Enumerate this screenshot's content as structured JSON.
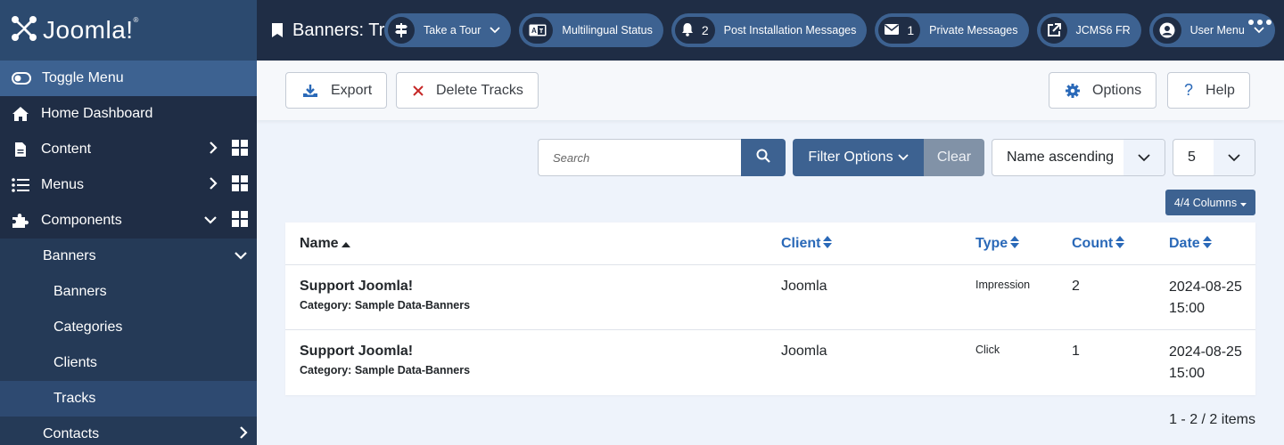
{
  "brand": {
    "logo_text": "Joomla!",
    "registered": "®"
  },
  "header": {
    "page_title": "Banners: Tracks",
    "pills": [
      {
        "label": "Take a Tour",
        "icon": "signpost-icon",
        "has_chevron": true
      },
      {
        "label": "Multilingual Status",
        "icon": "language-icon"
      },
      {
        "label": "Post Installation Messages",
        "icon": "bell-icon",
        "count": "2"
      },
      {
        "label": "Private Messages",
        "icon": "envelope-icon",
        "count": "1"
      },
      {
        "label": "JCMS6 FR",
        "icon": "external-link-icon"
      },
      {
        "label": "User Menu",
        "icon": "user-circle-icon",
        "has_chevron": true
      }
    ],
    "more_label": "More"
  },
  "sidebar": {
    "toggle_label": "Toggle Menu",
    "items": [
      {
        "label": "Home Dashboard",
        "icon": "home-icon"
      },
      {
        "label": "Content",
        "icon": "file-icon",
        "expanded": false
      },
      {
        "label": "Menus",
        "icon": "list-icon",
        "expanded": false
      },
      {
        "label": "Components",
        "icon": "puzzle-icon",
        "expanded": true
      }
    ],
    "components_children": [
      {
        "label": "Banners",
        "expanded": true,
        "children": [
          {
            "label": "Banners",
            "active": false
          },
          {
            "label": "Categories",
            "active": false
          },
          {
            "label": "Clients",
            "active": false
          },
          {
            "label": "Tracks",
            "active": true
          }
        ]
      },
      {
        "label": "Contacts",
        "expanded": false
      }
    ]
  },
  "toolbar": {
    "export_label": "Export",
    "delete_label": "Delete Tracks",
    "options_label": "Options",
    "help_label": "Help"
  },
  "filters": {
    "search_placeholder": "Search",
    "search_value": "",
    "filter_options_label": "Filter Options",
    "clear_label": "Clear",
    "ordering_value": "Name ascending",
    "limit_value": "5",
    "columns_label": "4/4 Columns"
  },
  "table": {
    "columns": [
      {
        "label": "Name",
        "sort": "asc"
      },
      {
        "label": "Client",
        "sort": "none"
      },
      {
        "label": "Type",
        "sort": "none"
      },
      {
        "label": "Count",
        "sort": "none"
      },
      {
        "label": "Date",
        "sort": "none"
      }
    ],
    "rows": [
      {
        "name": "Support Joomla!",
        "category": "Category: Sample Data-Banners",
        "client": "Joomla",
        "type": "Impression",
        "count": "2",
        "date": "2024-08-25",
        "time": "15:00"
      },
      {
        "name": "Support Joomla!",
        "category": "Category: Sample Data-Banners",
        "client": "Joomla",
        "type": "Click",
        "count": "1",
        "date": "2024-08-25",
        "time": "15:00"
      }
    ]
  },
  "pagination": {
    "info": "1 - 2 / 2 items"
  },
  "colors": {
    "sidebar_bg": "#1f2d45",
    "accent": "#3d6291",
    "link": "#2a69b8",
    "danger": "#c52827",
    "page_bg": "#eef3fb"
  }
}
